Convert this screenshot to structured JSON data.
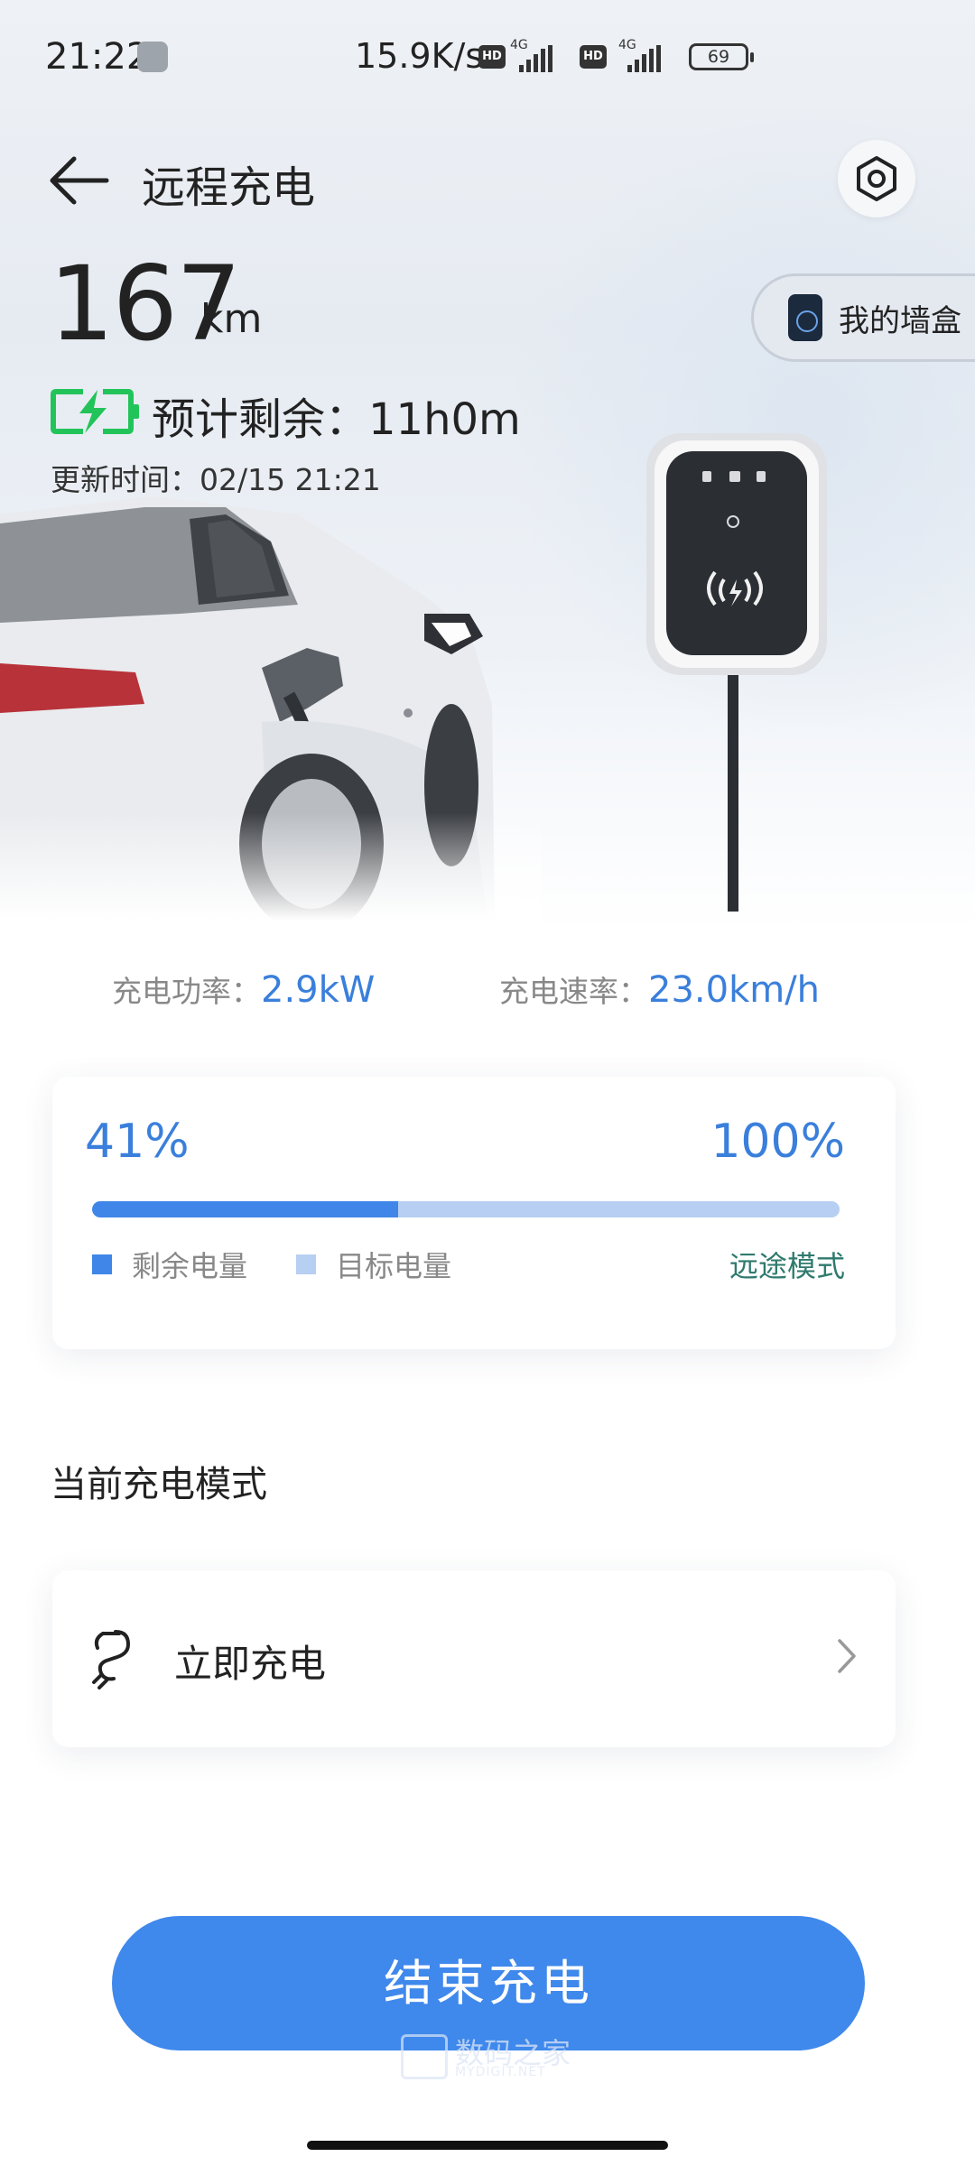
{
  "status_bar": {
    "time": "21:22",
    "net_speed": "15.9K/s",
    "hd_label": "HD",
    "network_type": "4G",
    "battery": "69"
  },
  "header": {
    "title": "远程充电",
    "back_icon": "arrow-left-icon",
    "settings_icon": "hexagon-settings-icon"
  },
  "vehicle": {
    "range_value": "167",
    "range_unit": "km",
    "eta_label": "预计剩余：11h0m",
    "updated_label": "更新时间：02/15 21:21",
    "wallbox_button": "我的墙盒"
  },
  "charging": {
    "power_label": "充电功率：",
    "power_value": "2.9kW",
    "speed_label": "充电速率：",
    "speed_value": "23.0km/h"
  },
  "soc": {
    "current_label": "41%",
    "target_label": "100%",
    "current_fraction": 0.41,
    "legend_remaining": "剩余电量",
    "legend_target": "目标电量",
    "trip_mode_link": "远途模式",
    "colors": {
      "remaining": "#3f86e8",
      "target": "#b7cff2",
      "link": "#2f7a6e"
    }
  },
  "mode": {
    "section_title": "当前充电模式",
    "current_mode": "立即充电",
    "mode_icon": "charging-plug-icon"
  },
  "actions": {
    "end_charging": "结束充电"
  },
  "watermark": {
    "main": "数码之家",
    "sub": "MYDIGIT.NET"
  },
  "accent_color": "#3f88ec"
}
